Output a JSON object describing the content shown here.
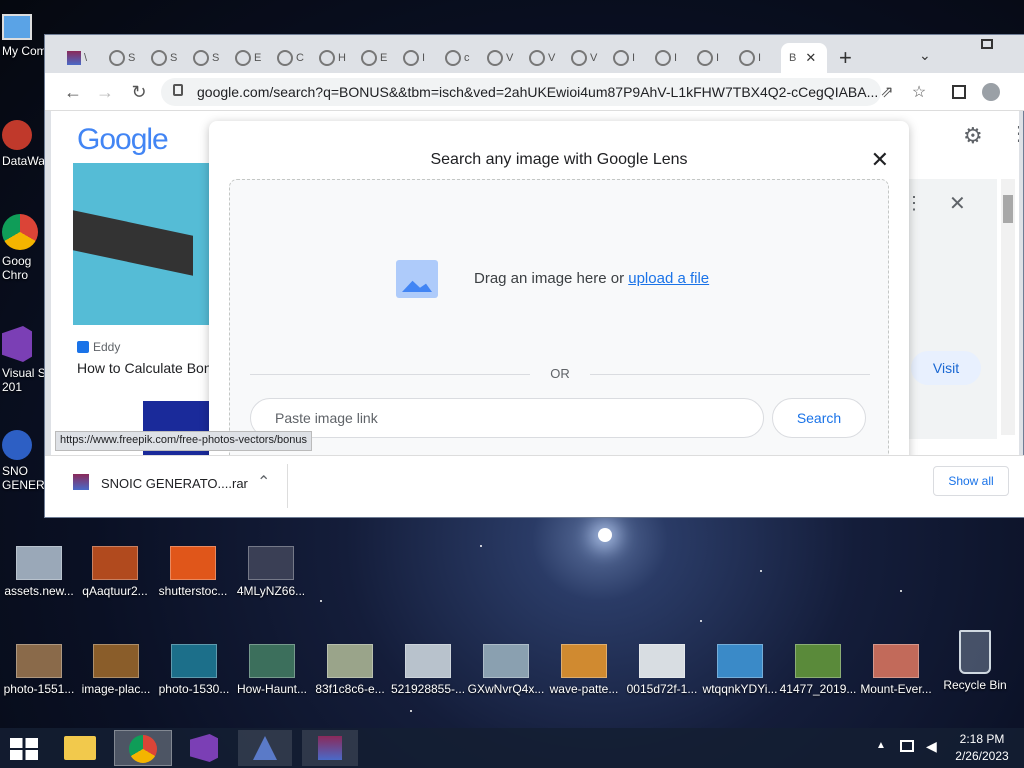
{
  "desktop": {
    "left_icons": [
      {
        "label": "My Com",
        "icon": "computer-icon"
      },
      {
        "label": "DataWa",
        "icon": "shortcut-icon"
      },
      {
        "label": "Goog Chro",
        "icon": "chrome-icon"
      },
      {
        "label": "Visual S 201",
        "icon": "visual-studio-icon"
      },
      {
        "label": "SNO GENERA",
        "icon": "app-icon"
      }
    ],
    "row1": [
      "assets.new...",
      "qAaqtuur2...",
      "shutterstoc...",
      "4MLyNZ66..."
    ],
    "row2": [
      "photo-1551...",
      "image-plac...",
      "photo-1530...",
      "How-Haunt...",
      "83f1c8c6-e...",
      "521928855-...",
      "GXwNvrQ4x...",
      "wave-patte...",
      "0015d72f-1...",
      "wtqqnkYDYi...",
      "41477_2019...",
      "Mount-Ever...",
      "Recycle Bin"
    ]
  },
  "browser": {
    "tabs": [
      "\\",
      "S",
      "S",
      "S",
      "E",
      "C",
      "H",
      "E",
      "I",
      "c",
      "V",
      "V",
      "V",
      "I",
      "I",
      "I"
    ],
    "active_tab": "B",
    "new_tab": "+",
    "url": "google.com/search?q=BONUS&&tbm=isch&ved=2ahUKEwioi4um87P9AhV-L1kFHW7TBX4Q2-cCegQIABA...",
    "google_logo": "Google",
    "card": {
      "source": "Eddy",
      "title": "How to Calculate Bon"
    },
    "visit_label": "Visit",
    "lens": {
      "title": "Search any image with Google Lens",
      "drag_text": "Drag an image here or ",
      "upload_link": "upload a file",
      "or": "OR",
      "paste_placeholder": "Paste image link",
      "search_label": "Search"
    },
    "status_url": "https://www.freepik.com/free-photos-vectors/bonus",
    "download": {
      "filename": "SNOIC GENERATO....rar",
      "show_all": "Show all"
    }
  },
  "taskbar": {
    "time": "2:18 PM",
    "date": "2/26/2023"
  }
}
